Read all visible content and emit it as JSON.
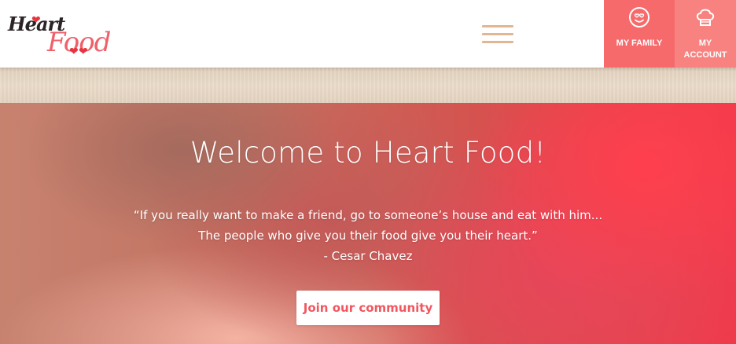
{
  "header": {
    "logo": {
      "line1": "Heart",
      "line2": "Food"
    },
    "menu_icon": "hamburger-menu-icon",
    "nav": [
      {
        "label": "MY FAMILY",
        "icon": "heart-eyes-smiley-icon",
        "color": "#f66a6c"
      },
      {
        "label_line1": "MY",
        "label_line2": "ACCOUNT",
        "icon": "chef-hat-icon",
        "color": "#f7827f"
      }
    ]
  },
  "hero": {
    "title": "Welcome to Heart Food!",
    "quote_line1": "“If you really want to make a friend, go to someone’s house and eat with him...",
    "quote_line2": "The people who give you their food give you their heart.”",
    "author": "- Cesar Chavez",
    "cta_label": "Join our community"
  },
  "colors": {
    "accent": "#f66a6c",
    "cta_text": "#f2565f",
    "menu_lines": "#e2b690"
  }
}
